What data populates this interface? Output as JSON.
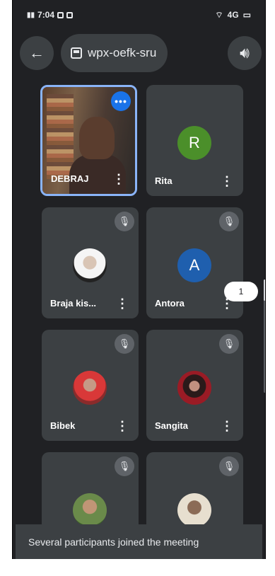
{
  "status_bar": {
    "time": "7:04",
    "signal": "▮▮▮",
    "network": "4G",
    "battery": "▭"
  },
  "header": {
    "back_icon": "arrow-left-icon",
    "meeting_code": "wpx-oefk-sru",
    "audio_icon": "speaker-icon"
  },
  "participants": [
    {
      "name": "DEBRAJ",
      "type": "self-video",
      "speaking": true
    },
    {
      "name": "Rita",
      "type": "initial",
      "initial": "R",
      "color": "#4b8f2a"
    },
    {
      "name": "Braja kis...",
      "type": "photo",
      "muted": true
    },
    {
      "name": "Antora",
      "type": "initial",
      "initial": "A",
      "color": "#1f5fae",
      "muted": true
    },
    {
      "name": "Bibek",
      "type": "photo",
      "muted": true
    },
    {
      "name": "Sangita",
      "type": "photo",
      "muted": true
    },
    {
      "name": "",
      "type": "photo",
      "muted": true
    },
    {
      "name": "",
      "type": "photo",
      "muted": true
    }
  ],
  "page_indicator": "1",
  "snackbar": {
    "text": "Several participants joined the meeting"
  },
  "colors": {
    "background": "#202124",
    "tile": "#3c4043",
    "accent": "#8ab4f8"
  }
}
